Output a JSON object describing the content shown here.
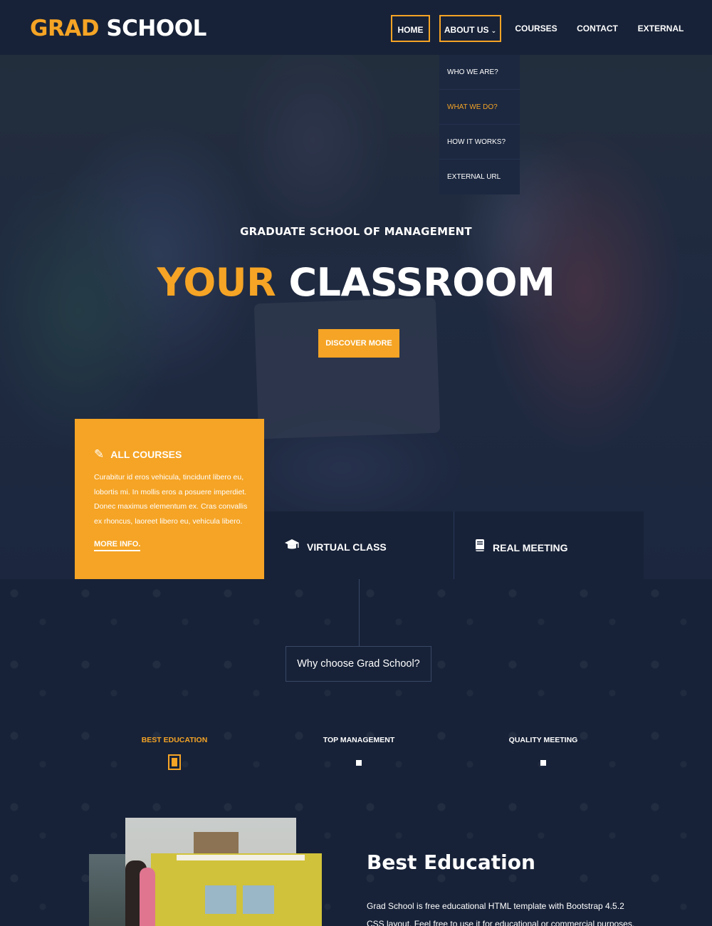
{
  "header": {
    "logo_part1": "GRAD",
    "logo_part2": "SCHOOL",
    "nav": {
      "home": "HOME",
      "about": "ABOUT US",
      "courses": "COURSES",
      "contact": "CONTACT",
      "external": "EXTERNAL"
    },
    "dropdown": [
      "WHO WE ARE?",
      "WHAT WE DO?",
      "HOW IT WORKS?",
      "EXTERNAL URL"
    ]
  },
  "hero": {
    "subtitle": "GRADUATE SCHOOL OF MANAGEMENT",
    "title_part1": "YOUR",
    "title_part2": "CLASSROOM",
    "button": "DISCOVER MORE"
  },
  "features": {
    "all_courses": {
      "title": "ALL COURSES",
      "text": "Curabitur id eros vehicula, tincidunt libero eu, lobortis mi. In mollis eros a posuere imperdiet. Donec maximus elementum ex. Cras convallis ex rhoncus, laoreet libero eu, vehicula libero.",
      "link": "MORE INFO."
    },
    "virtual_class": "VIRTUAL CLASS",
    "real_meeting": "REAL MEETING"
  },
  "why": {
    "heading": "Why choose Grad School?",
    "tabs": [
      "BEST EDUCATION",
      "TOP MANAGEMENT",
      "QUALITY MEETING"
    ],
    "content_title": "Best Education",
    "content_text": "Grad School is free educational HTML template with Bootstrap 4.5.2 CSS layout. Feel free to use it for educational or commercial purposes."
  },
  "colors": {
    "accent": "#f5a425",
    "navy": "#172238"
  },
  "icons": {
    "pencil": "pencil-icon",
    "graduation": "graduation-cap-icon",
    "book": "book-icon",
    "chevron": "chevron-down-icon"
  }
}
